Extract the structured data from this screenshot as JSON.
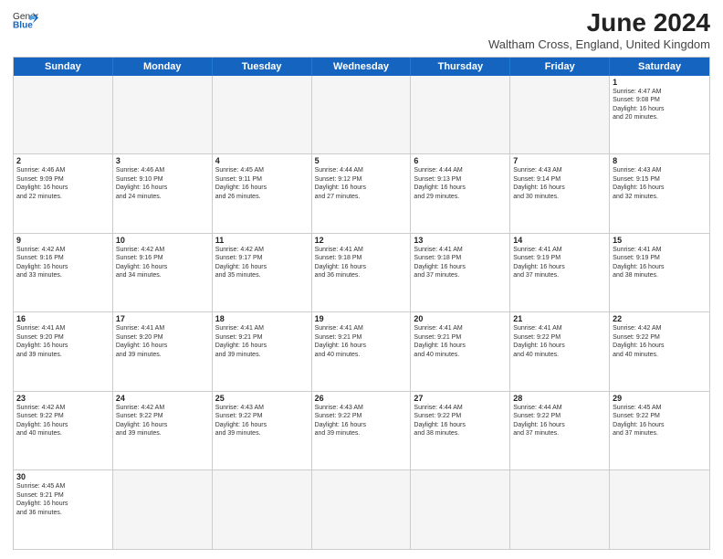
{
  "header": {
    "logo_general": "General",
    "logo_blue": "Blue",
    "month_year": "June 2024",
    "location": "Waltham Cross, England, United Kingdom"
  },
  "weekdays": [
    "Sunday",
    "Monday",
    "Tuesday",
    "Wednesday",
    "Thursday",
    "Friday",
    "Saturday"
  ],
  "rows": [
    [
      {
        "day": "",
        "info": ""
      },
      {
        "day": "",
        "info": ""
      },
      {
        "day": "",
        "info": ""
      },
      {
        "day": "",
        "info": ""
      },
      {
        "day": "",
        "info": ""
      },
      {
        "day": "",
        "info": ""
      },
      {
        "day": "1",
        "info": "Sunrise: 4:47 AM\nSunset: 9:08 PM\nDaylight: 16 hours\nand 20 minutes."
      }
    ],
    [
      {
        "day": "2",
        "info": "Sunrise: 4:46 AM\nSunset: 9:09 PM\nDaylight: 16 hours\nand 22 minutes."
      },
      {
        "day": "3",
        "info": "Sunrise: 4:46 AM\nSunset: 9:10 PM\nDaylight: 16 hours\nand 24 minutes."
      },
      {
        "day": "4",
        "info": "Sunrise: 4:45 AM\nSunset: 9:11 PM\nDaylight: 16 hours\nand 26 minutes."
      },
      {
        "day": "5",
        "info": "Sunrise: 4:44 AM\nSunset: 9:12 PM\nDaylight: 16 hours\nand 27 minutes."
      },
      {
        "day": "6",
        "info": "Sunrise: 4:44 AM\nSunset: 9:13 PM\nDaylight: 16 hours\nand 29 minutes."
      },
      {
        "day": "7",
        "info": "Sunrise: 4:43 AM\nSunset: 9:14 PM\nDaylight: 16 hours\nand 30 minutes."
      },
      {
        "day": "8",
        "info": "Sunrise: 4:43 AM\nSunset: 9:15 PM\nDaylight: 16 hours\nand 32 minutes."
      }
    ],
    [
      {
        "day": "9",
        "info": "Sunrise: 4:42 AM\nSunset: 9:16 PM\nDaylight: 16 hours\nand 33 minutes."
      },
      {
        "day": "10",
        "info": "Sunrise: 4:42 AM\nSunset: 9:16 PM\nDaylight: 16 hours\nand 34 minutes."
      },
      {
        "day": "11",
        "info": "Sunrise: 4:42 AM\nSunset: 9:17 PM\nDaylight: 16 hours\nand 35 minutes."
      },
      {
        "day": "12",
        "info": "Sunrise: 4:41 AM\nSunset: 9:18 PM\nDaylight: 16 hours\nand 36 minutes."
      },
      {
        "day": "13",
        "info": "Sunrise: 4:41 AM\nSunset: 9:18 PM\nDaylight: 16 hours\nand 37 minutes."
      },
      {
        "day": "14",
        "info": "Sunrise: 4:41 AM\nSunset: 9:19 PM\nDaylight: 16 hours\nand 37 minutes."
      },
      {
        "day": "15",
        "info": "Sunrise: 4:41 AM\nSunset: 9:19 PM\nDaylight: 16 hours\nand 38 minutes."
      }
    ],
    [
      {
        "day": "16",
        "info": "Sunrise: 4:41 AM\nSunset: 9:20 PM\nDaylight: 16 hours\nand 39 minutes."
      },
      {
        "day": "17",
        "info": "Sunrise: 4:41 AM\nSunset: 9:20 PM\nDaylight: 16 hours\nand 39 minutes."
      },
      {
        "day": "18",
        "info": "Sunrise: 4:41 AM\nSunset: 9:21 PM\nDaylight: 16 hours\nand 39 minutes."
      },
      {
        "day": "19",
        "info": "Sunrise: 4:41 AM\nSunset: 9:21 PM\nDaylight: 16 hours\nand 40 minutes."
      },
      {
        "day": "20",
        "info": "Sunrise: 4:41 AM\nSunset: 9:21 PM\nDaylight: 16 hours\nand 40 minutes."
      },
      {
        "day": "21",
        "info": "Sunrise: 4:41 AM\nSunset: 9:22 PM\nDaylight: 16 hours\nand 40 minutes."
      },
      {
        "day": "22",
        "info": "Sunrise: 4:42 AM\nSunset: 9:22 PM\nDaylight: 16 hours\nand 40 minutes."
      }
    ],
    [
      {
        "day": "23",
        "info": "Sunrise: 4:42 AM\nSunset: 9:22 PM\nDaylight: 16 hours\nand 40 minutes."
      },
      {
        "day": "24",
        "info": "Sunrise: 4:42 AM\nSunset: 9:22 PM\nDaylight: 16 hours\nand 39 minutes."
      },
      {
        "day": "25",
        "info": "Sunrise: 4:43 AM\nSunset: 9:22 PM\nDaylight: 16 hours\nand 39 minutes."
      },
      {
        "day": "26",
        "info": "Sunrise: 4:43 AM\nSunset: 9:22 PM\nDaylight: 16 hours\nand 39 minutes."
      },
      {
        "day": "27",
        "info": "Sunrise: 4:44 AM\nSunset: 9:22 PM\nDaylight: 16 hours\nand 38 minutes."
      },
      {
        "day": "28",
        "info": "Sunrise: 4:44 AM\nSunset: 9:22 PM\nDaylight: 16 hours\nand 37 minutes."
      },
      {
        "day": "29",
        "info": "Sunrise: 4:45 AM\nSunset: 9:22 PM\nDaylight: 16 hours\nand 37 minutes."
      }
    ],
    [
      {
        "day": "30",
        "info": "Sunrise: 4:45 AM\nSunset: 9:21 PM\nDaylight: 16 hours\nand 36 minutes."
      },
      {
        "day": "",
        "info": ""
      },
      {
        "day": "",
        "info": ""
      },
      {
        "day": "",
        "info": ""
      },
      {
        "day": "",
        "info": ""
      },
      {
        "day": "",
        "info": ""
      },
      {
        "day": "",
        "info": ""
      }
    ]
  ]
}
